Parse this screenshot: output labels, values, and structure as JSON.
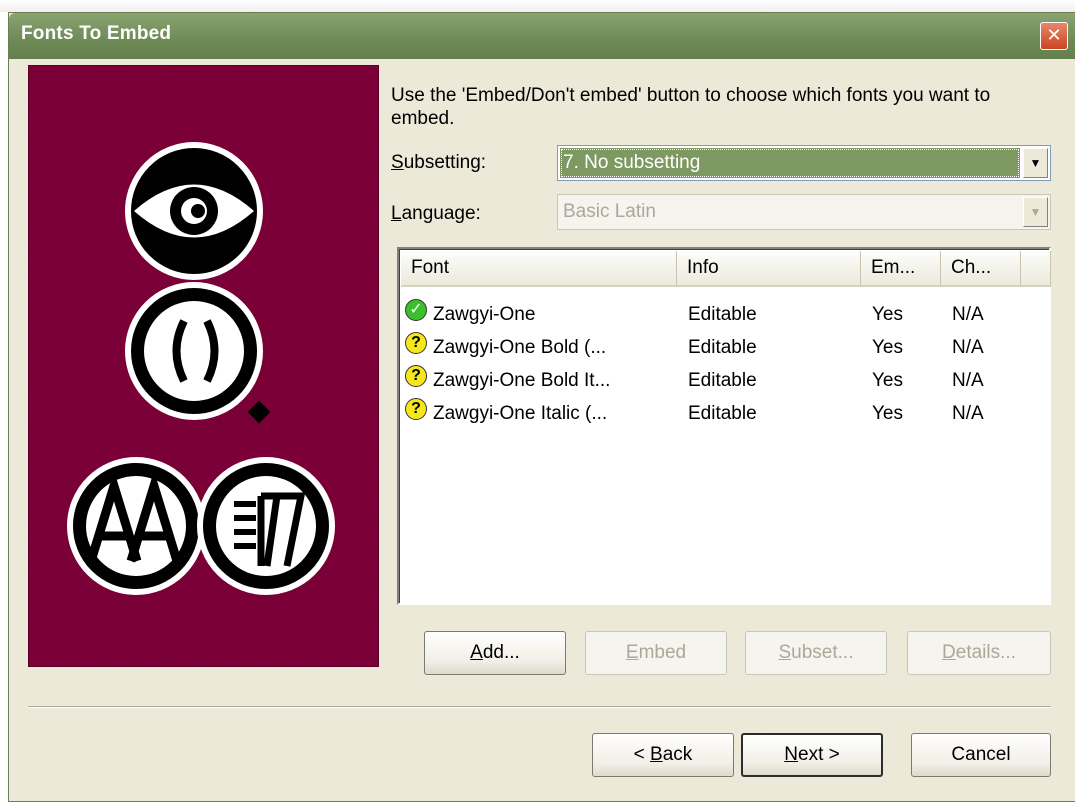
{
  "window": {
    "title": "Fonts To Embed",
    "close_label": "✕"
  },
  "instruction": "Use the 'Embed/Don't embed' button to choose which fonts you want to embed.",
  "subsetting": {
    "label_key": "S",
    "label_rest": "ubsetting:",
    "value": "7. No subsetting"
  },
  "language": {
    "label_key": "L",
    "label_rest": "anguage:",
    "value": "Basic Latin"
  },
  "font_list": {
    "columns": [
      "Font",
      "Info",
      "Em...",
      "Ch..."
    ],
    "rows": [
      {
        "icon": "check-icon",
        "font": "Zawgyi-One",
        "info": "Editable",
        "embed": "Yes",
        "ch": "N/A"
      },
      {
        "icon": "question-icon",
        "font": "Zawgyi-One Bold (...",
        "info": "Editable",
        "embed": "Yes",
        "ch": "N/A"
      },
      {
        "icon": "question-icon",
        "font": "Zawgyi-One Bold It...",
        "info": "Editable",
        "embed": "Yes",
        "ch": "N/A"
      },
      {
        "icon": "question-icon",
        "font": "Zawgyi-One Italic (...",
        "info": "Editable",
        "embed": "Yes",
        "ch": "N/A"
      }
    ]
  },
  "list_buttons": {
    "add": {
      "key": "A",
      "rest": "dd..."
    },
    "embed": {
      "key": "E",
      "rest": "mbed"
    },
    "subset": {
      "key": "S",
      "rest": "ubset..."
    },
    "details": {
      "key": "D",
      "rest": "etails..."
    }
  },
  "nav_buttons": {
    "back": {
      "pre": "< ",
      "key": "B",
      "rest": "ack"
    },
    "next": {
      "key": "N",
      "rest": "ext >"
    },
    "cancel": "Cancel"
  },
  "colors": {
    "art_background": "#7d0038",
    "titlebar": "#6e8a56",
    "selection": "#7d9861"
  }
}
